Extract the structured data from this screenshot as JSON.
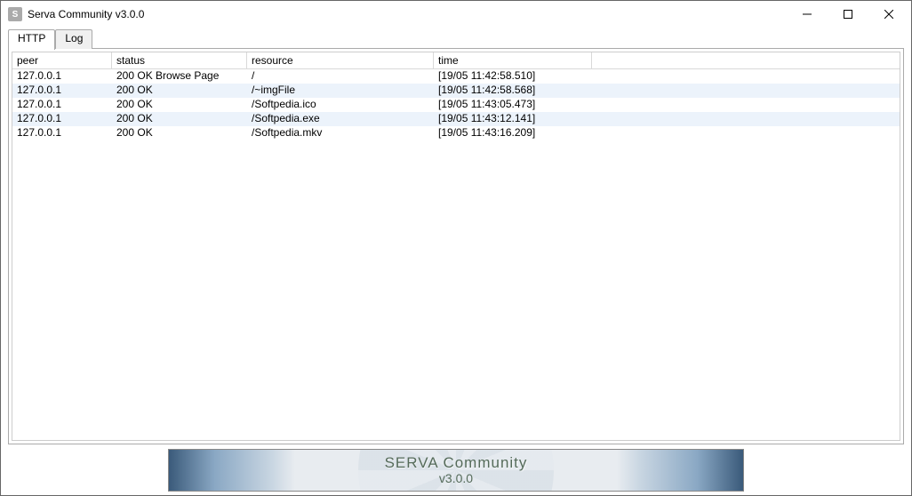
{
  "window": {
    "title": "Serva Community v3.0.0",
    "icon_label": "S"
  },
  "tabs": [
    {
      "label": "HTTP",
      "active": true
    },
    {
      "label": "Log",
      "active": false
    }
  ],
  "columns": {
    "peer": "peer",
    "status": "status",
    "resource": "resource",
    "time": "time"
  },
  "rows": [
    {
      "peer": "127.0.0.1",
      "status": "200 OK Browse Page",
      "resource": "/",
      "time": "[19/05 11:42:58.510]"
    },
    {
      "peer": "127.0.0.1",
      "status": "200 OK",
      "resource": "/~imgFile",
      "time": "[19/05 11:42:58.568]"
    },
    {
      "peer": "127.0.0.1",
      "status": "200 OK",
      "resource": "/Softpedia.ico",
      "time": "[19/05 11:43:05.473]"
    },
    {
      "peer": "127.0.0.1",
      "status": "200 OK",
      "resource": "/Softpedia.exe",
      "time": "[19/05 11:43:12.141]"
    },
    {
      "peer": "127.0.0.1",
      "status": "200 OK",
      "resource": "/Softpedia.mkv",
      "time": "[19/05 11:43:16.209]"
    }
  ],
  "banner": {
    "title": "SERVA Community",
    "version": "v3.0.0"
  }
}
